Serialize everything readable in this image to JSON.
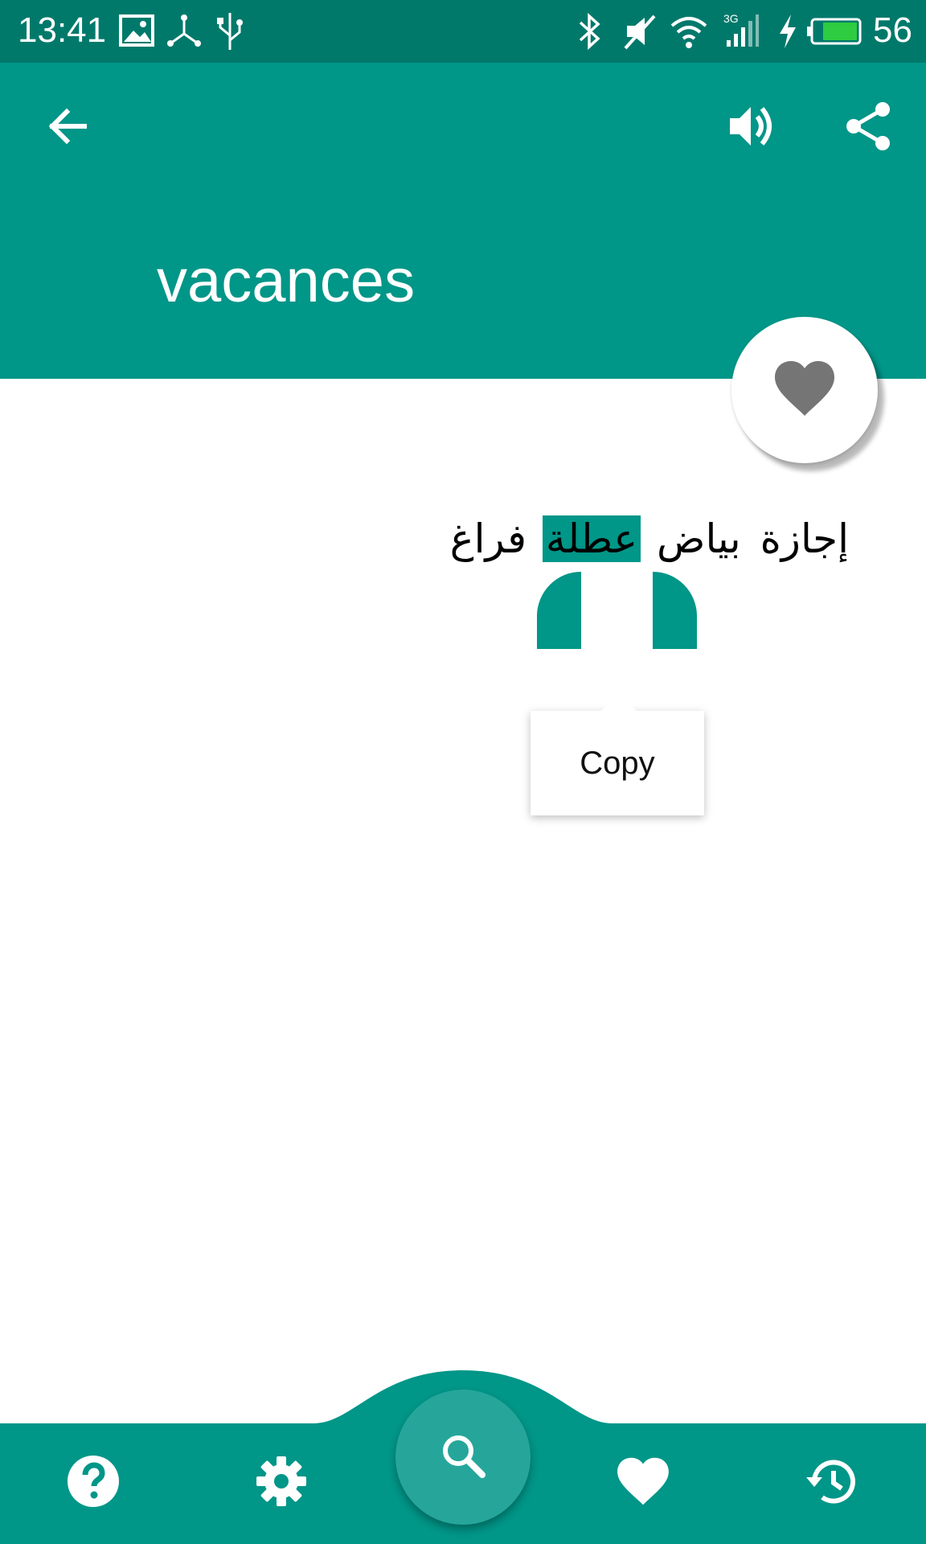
{
  "status_bar": {
    "time": "13:41",
    "battery_level": "56",
    "icons": [
      "image-icon",
      "usb-network-icon",
      "usb-icon",
      "bluetooth-icon",
      "mute-icon",
      "wifi-icon",
      "signal-3g-icon",
      "charging-icon",
      "battery-icon"
    ]
  },
  "app_bar": {
    "back_icon": "arrow-left-icon",
    "speak_icon": "volume-icon",
    "share_icon": "share-icon",
    "word": "vacances"
  },
  "favorite_icon": "heart-icon",
  "translation": {
    "words": [
      "إجازة",
      "بياض",
      "عطلة",
      "فراغ"
    ],
    "selected_index": 2
  },
  "selection_popup": {
    "copy_label": "Copy"
  },
  "bottom_nav": {
    "items": [
      "help-icon",
      "settings-icon",
      "search-icon",
      "favorites-icon",
      "history-icon"
    ]
  },
  "colors": {
    "primary": "#009688",
    "primary_dark": "#00796b",
    "fab": "#26a69a",
    "heart_gray": "#757575"
  }
}
